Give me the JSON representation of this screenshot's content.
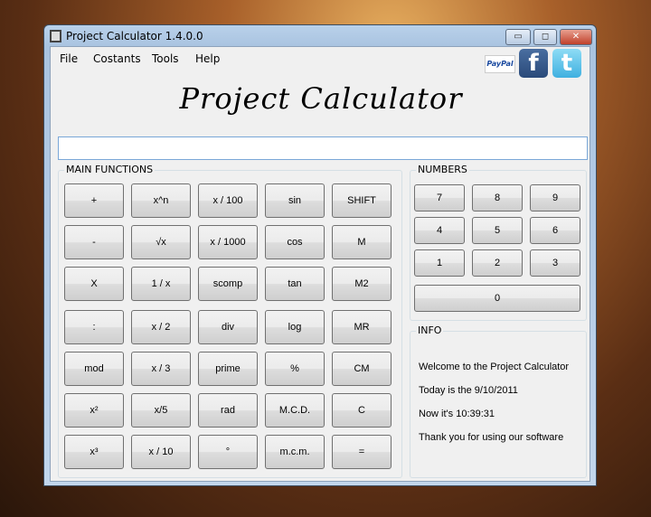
{
  "window": {
    "title": "Project Calculator 1.4.0.0",
    "minimize": "▭",
    "restore": "◻",
    "close": "✕"
  },
  "menu": [
    "File",
    "Costants",
    "Tools",
    "Help"
  ],
  "social": {
    "paypal": "PayPal",
    "facebook": "f",
    "twitter": "t"
  },
  "logo": "Project Calculator",
  "display": {
    "value": ""
  },
  "main_functions": {
    "label": "MAIN FUNCTIONS",
    "buttons": [
      [
        "+",
        "x^n",
        "x / 100",
        "sin",
        "SHIFT"
      ],
      [
        "-",
        "√x",
        "x / 1000",
        "cos",
        "M"
      ],
      [
        "X",
        "1 / x",
        "scomp",
        "tan",
        "M2"
      ],
      [
        ":",
        "x / 2",
        "div",
        "log",
        "MR"
      ],
      [
        "mod",
        "x / 3",
        "prime",
        "%",
        "CM"
      ],
      [
        "x²",
        "x/5",
        "rad",
        "M.C.D.",
        "C"
      ],
      [
        "x³",
        "x / 10",
        "°",
        "m.c.m.",
        "="
      ]
    ]
  },
  "numbers": {
    "label": "NUMBERS",
    "buttons": [
      [
        "7",
        "8",
        "9"
      ],
      [
        "4",
        "5",
        "6"
      ],
      [
        "1",
        "2",
        "3"
      ]
    ],
    "zero": "0"
  },
  "info": {
    "label": "INFO",
    "lines": [
      "Welcome to the Project Calculator",
      "Today is the 9/10/2011",
      "Now it's 10:39:31",
      "Thank you for using our software"
    ]
  }
}
